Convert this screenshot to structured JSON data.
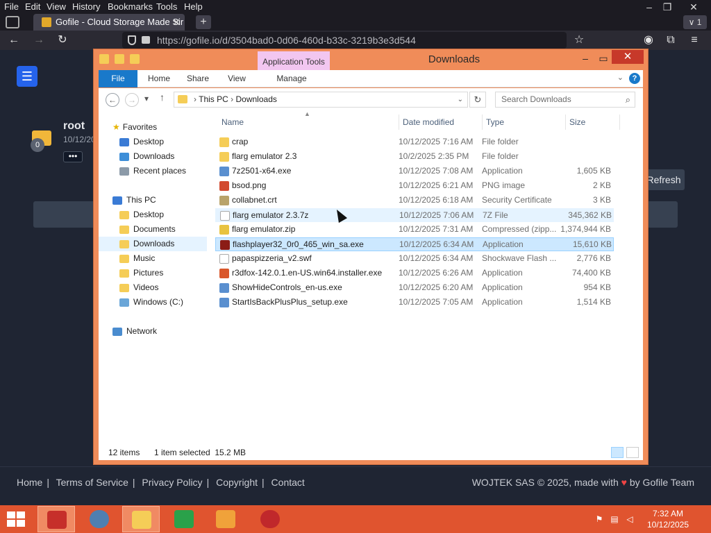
{
  "browser": {
    "menu": [
      "File",
      "Edit",
      "View",
      "History",
      "Bookmarks",
      "Tools",
      "Help"
    ],
    "tab_title": "Gofile - Cloud Storage Made Sir",
    "tabs_count": "1",
    "url": "https://gofile.io/d/3504bad0-0d06-460d-b33c-3219b3e3d544"
  },
  "webpage": {
    "folder_badge": "0",
    "folder_name": "root",
    "folder_date": "10/12/20",
    "more": "•••",
    "refresh": "Refresh",
    "footer_links": [
      "Home",
      "Terms of Service",
      "Privacy Policy",
      "Copyright",
      "Contact"
    ],
    "footer_copy_prefix": "WOJTEK SAS © 2025, made with",
    "footer_copy_suffix": "by Gofile Team"
  },
  "explorer": {
    "title": "Downloads",
    "app_tools": "Application Tools",
    "ribbon_tabs": [
      "File",
      "Home",
      "Share",
      "View",
      "Manage"
    ],
    "address": [
      "This PC",
      "Downloads"
    ],
    "search_placeholder": "Search Downloads",
    "nav": {
      "favorites": "Favorites",
      "fav_items": [
        "Desktop",
        "Downloads",
        "Recent places"
      ],
      "this_pc": "This PC",
      "pc_items": [
        "Desktop",
        "Documents",
        "Downloads",
        "Music",
        "Pictures",
        "Videos",
        "Windows (C:)"
      ],
      "network": "Network"
    },
    "columns": [
      "Name",
      "Date modified",
      "Type",
      "Size"
    ],
    "files": [
      {
        "name": "crap",
        "date": "10/12/2025 7:16 AM",
        "type": "File folder",
        "size": ""
      },
      {
        "name": "flarg emulator 2.3",
        "date": "10/2/2025 2:35 PM",
        "type": "File folder",
        "size": ""
      },
      {
        "name": "7z2501-x64.exe",
        "date": "10/12/2025 7:08 AM",
        "type": "Application",
        "size": "1,605 KB"
      },
      {
        "name": "bsod.png",
        "date": "10/12/2025 6:21 AM",
        "type": "PNG image",
        "size": "2 KB"
      },
      {
        "name": "collabnet.crt",
        "date": "10/12/2025 6:18 AM",
        "type": "Security Certificate",
        "size": "3 KB"
      },
      {
        "name": "flarg emulator 2.3.7z",
        "date": "10/12/2025 7:06 AM",
        "type": "7Z File",
        "size": "345,362 KB"
      },
      {
        "name": "flarg emulator.zip",
        "date": "10/12/2025 7:31 AM",
        "type": "Compressed (zipp...",
        "size": "1,374,944 KB"
      },
      {
        "name": "flashplayer32_0r0_465_win_sa.exe",
        "date": "10/12/2025 6:34 AM",
        "type": "Application",
        "size": "15,610 KB"
      },
      {
        "name": "papaspizzeria_v2.swf",
        "date": "10/12/2025 6:34 AM",
        "type": "Shockwave Flash ...",
        "size": "2,776 KB"
      },
      {
        "name": "r3dfox-142.0.1.en-US.win64.installer.exe",
        "date": "10/12/2025 6:26 AM",
        "type": "Application",
        "size": "74,400 KB"
      },
      {
        "name": "ShowHideControls_en-us.exe",
        "date": "10/12/2025 6:20 AM",
        "type": "Application",
        "size": "954 KB"
      },
      {
        "name": "StartIsBackPlusPlus_setup.exe",
        "date": "10/12/2025 7:05 AM",
        "type": "Application",
        "size": "1,514 KB"
      }
    ],
    "status_items": "12 items",
    "status_selected": "1 item selected  15.2 MB"
  },
  "taskbar": {
    "time": "7:32 AM",
    "date": "10/12/2025"
  },
  "colors": {
    "explorer_frame": "#f08c59",
    "taskbar": "#e0542f",
    "selection": "#cce8ff",
    "accent_blue": "#1979ca"
  }
}
